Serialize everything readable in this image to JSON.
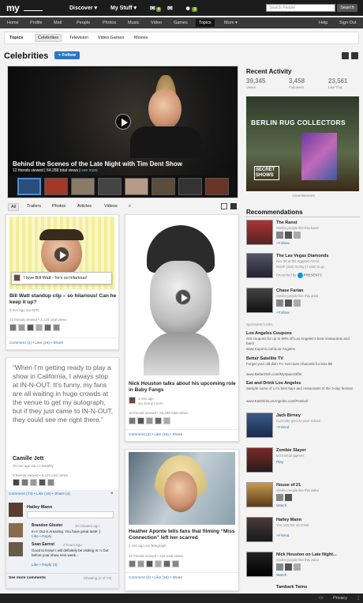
{
  "app": {
    "logo": "my"
  },
  "topbar": {
    "discover": "Discover",
    "mystuff": "My Stuff",
    "badge1": "4",
    "badge2": "3",
    "search_placeholder": "Search People",
    "search_btn": "Search"
  },
  "nav": {
    "items": [
      "Home",
      "Profile",
      "Mail",
      "People",
      "Photos",
      "Music",
      "Video",
      "Games",
      "Topics",
      "More ▾"
    ],
    "active": "Topics",
    "help": "Help",
    "signout": "Sign Out"
  },
  "subnav": {
    "items": [
      "Topics",
      "Celebrities",
      "Television",
      "Video Games",
      "Movies"
    ],
    "active": "Celebrities"
  },
  "page": {
    "title": "Celebrities",
    "follow": "+ Follow"
  },
  "hero": {
    "title": "Behind the Scenes of the Late Night with Tim Dent Show",
    "meta": "12 friends viewed | 64,268 total views |",
    "more": "see more"
  },
  "filters": {
    "items": [
      "All",
      "Trailers",
      "Photos",
      "Articles",
      "Videos"
    ],
    "active": "All"
  },
  "cards": {
    "c1": {
      "caption": "I love Bill Watt - he's so hilarious!",
      "title": "Bill Watt standup clip – so hilarious! Can he keep it up?",
      "meta": "9 min ago via NFR",
      "viewed": "22 friends viewed • 2,123 total views",
      "actions": "Comment (2) • Like (16) • Share"
    },
    "c2": {
      "quote": "“When I’m getting ready to play a show in California, I always stop at IN-N-OUT. It’s funny, my fans are all waiting in huge crowds at the venue to get my autograph, but if they just came to IN-N-OUT, they could see me right there.”",
      "author": "Camille Jett",
      "meta": "10 min ago via LA Weekly",
      "viewed": "9 friends viewed • 9,124 total views",
      "actions": "Comment (73) • Like (16) • Share (4)",
      "comments": [
        {
          "name": "Hailey Mann",
          "time": "",
          "text": ""
        },
        {
          "name": "Brandon Gloster",
          "time": "30 minutes ago",
          "text": "In n' Out is Amazing. You have great taste :)"
        },
        {
          "name": "Sean Earnst",
          "time": "2 hours ago",
          "text": "Good to know! I will definitely be visiting In 'n Out before your show next week..."
        }
      ],
      "reply": "Like • Reply (3)",
      "seemore": "See more comments",
      "showing": "Showing (2 of 73)"
    },
    "c3": {
      "title": "Nick Houston talks about his upcoming role in Baby Fangs",
      "meta": "4 min ago",
      "via": "via Jenny Fontz",
      "viewed": "10 friends viewed • 29,356 total views",
      "actions": "Comment (2) • Like (16) • Share"
    },
    "c4": {
      "title": "Heather Aponte tells fans that filming “Miss Connection” left her scarred",
      "meta": "2 min ago via Telegraph",
      "viewed": "12 friends viewed • 218 total views",
      "actions": "Comment (2) • Like (16) • Share"
    }
  },
  "activity": {
    "title": "Recent Activity",
    "views": "39,345",
    "views_l": "Views",
    "followers": "3,458",
    "followers_l": "Followers",
    "likes": "23,561",
    "likes_l": "Like This"
  },
  "ad": {
    "text": "BERLIN RUG COLLECTORS",
    "shows": "SECRET SHOWS",
    "label": "Advertisement"
  },
  "recs": {
    "title": "Recommendations",
    "items": [
      {
        "name": "The Ranst",
        "desc": "Similar people like this band",
        "action": "+Follow"
      },
      {
        "name": "The Las Vegas Diamonds",
        "desc": "Nov 08 at the Agganis Arena",
        "desc2": "RSVP (324) Going | I want to go",
        "desc3": "Presented by",
        "desc4": "PRESENTS",
        "action": ""
      },
      {
        "name": "Chase Farian",
        "desc": "Similar people like this artist",
        "action": "+Follow"
      },
      {
        "name": "Jack Birney",
        "desc": "Currently goes to your school",
        "action": "+Friend"
      },
      {
        "name": "Zombie Slayer",
        "desc": "6/4 mutual gamers",
        "action": "Play"
      },
      {
        "name": "House of 21",
        "desc": "Similar people like this video",
        "action": "Watch"
      },
      {
        "name": "Hailey Mann",
        "desc": "You sent her an email",
        "action": "+Friend"
      },
      {
        "name": "Nick Houston on Late Night...",
        "desc": "Similar people like this video",
        "action": "Watch"
      },
      {
        "name": "Tambark Twins",
        "desc": "",
        "action": ""
      }
    ]
  },
  "sponsored": {
    "label": "Sponsored Links",
    "links": [
      {
        "title": "Los Angeles Coupons",
        "desc": "Get coupons for up to 90% off Los Angeles's best restaurants and bars!",
        "url": "www.Kupons.com/Los-Angeles"
      },
      {
        "title": "Better Satellite TV",
        "desc": "Forget your old dish TV. Get more channels for less $$",
        "url": "www.BetterDish.com/MyspaceOffer"
      },
      {
        "title": "Eat and Drink Los Angeles",
        "desc": "Sample some of LA's best bars and restaurants in the 3-day festival.",
        "url": "www.EatDrinkLosAngeles.com/Festival"
      }
    ]
  },
  "footer": {
    "privacy": "Privacy"
  }
}
